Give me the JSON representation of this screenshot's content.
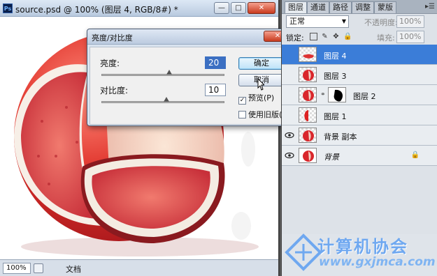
{
  "document": {
    "title": "source.psd @ 100% (图层 4, RGB/8#) *",
    "app_icon": "Ps",
    "zoom": "100%",
    "status_label": "文档"
  },
  "dialog": {
    "title": "亮度/对比度",
    "brightness_label": "亮度:",
    "brightness_value": "20",
    "brightness_level": 0.55,
    "contrast_label": "对比度:",
    "contrast_value": "10",
    "contrast_level": 0.53,
    "ok_label": "确定",
    "cancel_label": "取消",
    "preview_label": "预览(P)",
    "preview_checked": true,
    "legacy_label": "使用旧版(L)",
    "legacy_checked": false
  },
  "panel": {
    "tabs": [
      "图层",
      "通道",
      "路径",
      "调整",
      "蒙版"
    ],
    "blend_mode": "正常",
    "opacity_label": "不透明度:",
    "opacity_value": "100%",
    "lock_label": "锁定:",
    "fill_label": "填充:",
    "fill_value": "100%",
    "layers": [
      {
        "name": "图层 4",
        "active": true,
        "visible": false,
        "thumb": "slice",
        "mask": false,
        "locked": false
      },
      {
        "name": "图层 3",
        "active": false,
        "visible": false,
        "thumb": "apple",
        "mask": false,
        "locked": false
      },
      {
        "name": "图层 2",
        "active": false,
        "visible": false,
        "thumb": "apple",
        "mask": true,
        "locked": false
      },
      {
        "name": "图层 1",
        "active": false,
        "visible": false,
        "thumb": "half",
        "mask": false,
        "locked": false
      },
      {
        "name": "背景 副本",
        "active": false,
        "visible": true,
        "thumb": "apple",
        "mask": false,
        "locked": false
      },
      {
        "name": "背景",
        "active": false,
        "visible": true,
        "thumb": "apple-white",
        "mask": false,
        "locked": true
      }
    ]
  },
  "watermark": {
    "line1": "计算机协会",
    "line2": "www.gxjmca.com"
  },
  "colors": {
    "selected_layer": "#3b7dd8",
    "apple_red": "#d9262b",
    "flesh_red": "#d84545"
  }
}
